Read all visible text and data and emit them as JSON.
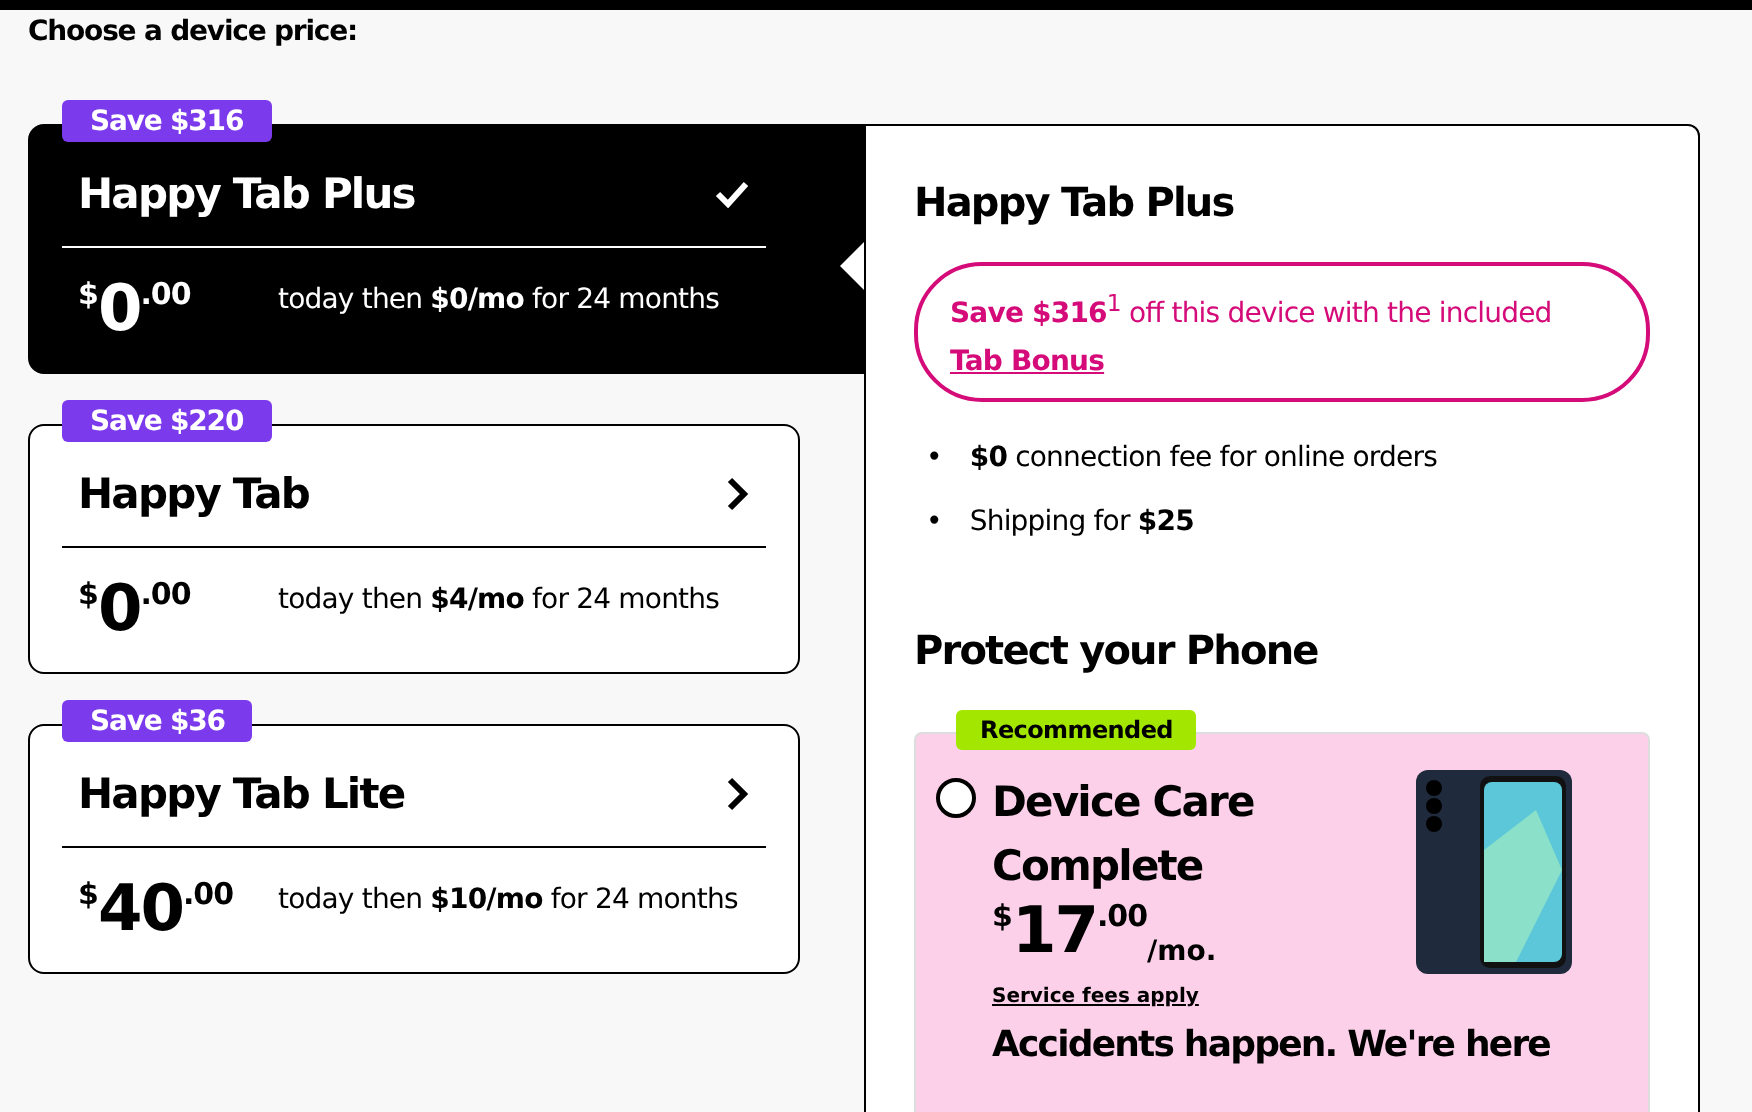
{
  "heading": "Choose a device price:",
  "options": [
    {
      "badge": "Save $316",
      "name": "Happy Tab Plus",
      "selected": true,
      "currency": "$",
      "whole": "0",
      "cents": ".00",
      "terms": "today then **$0/mo** for 24 months"
    },
    {
      "badge": "Save $220",
      "name": "Happy Tab",
      "selected": false,
      "currency": "$",
      "whole": "0",
      "cents": ".00",
      "terms": "today then **$4/mo** for 24 months"
    },
    {
      "badge": "Save $36",
      "name": "Happy Tab Lite",
      "selected": false,
      "currency": "$",
      "whole": "40",
      "cents": ".00",
      "terms": "today then **$10/mo** for 24 months"
    }
  ],
  "details": {
    "title": "Happy Tab Plus",
    "promo": "**Save $316**$^{1}$ off this device with the included",
    "promo_link": "Tab Bonus",
    "bullets": [
      {
        "marker": "•",
        "text": "**$0** connection fee for online orders"
      },
      {
        "marker": "•",
        "text": "Shipping for **$25**"
      }
    ]
  },
  "protection": {
    "title": "Protect your Phone",
    "badge": "Recommended",
    "selected": false,
    "name": "Device Care Complete",
    "currency": "$",
    "whole": "17",
    "cents": ".00",
    "period": "/mo.",
    "fees_link": "Service fees apply",
    "tagline": "Accidents happen. We're here"
  }
}
